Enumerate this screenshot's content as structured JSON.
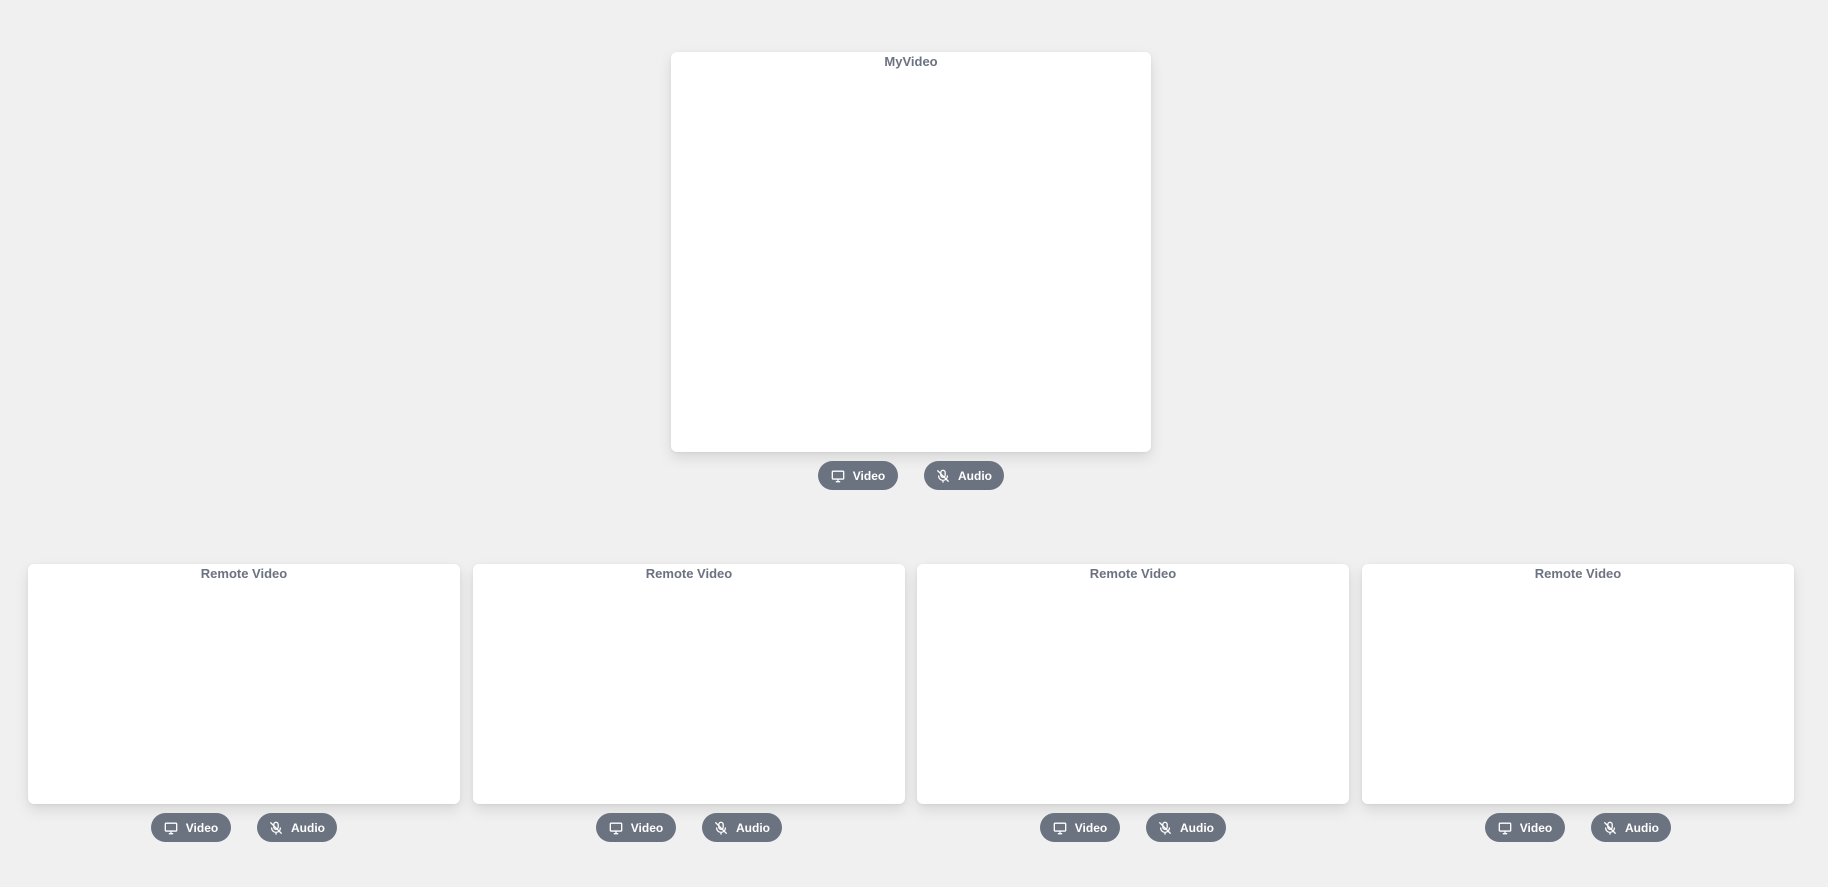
{
  "my_video": {
    "title": "MyVideo",
    "video_label": "Video",
    "audio_label": "Audio",
    "video_icon": "monitor-icon",
    "audio_icon": "mic-off-icon"
  },
  "remote_videos": [
    {
      "title": "Remote Video",
      "video_label": "Video",
      "audio_label": "Audio"
    },
    {
      "title": "Remote Video",
      "video_label": "Video",
      "audio_label": "Audio"
    },
    {
      "title": "Remote Video",
      "video_label": "Video",
      "audio_label": "Audio"
    },
    {
      "title": "Remote Video",
      "video_label": "Video",
      "audio_label": "Audio"
    }
  ],
  "colors": {
    "background": "#f0f0f0",
    "panel": "#ffffff",
    "title_text": "#6b7280",
    "button_bg": "#6b7280",
    "button_text": "#ffffff"
  }
}
